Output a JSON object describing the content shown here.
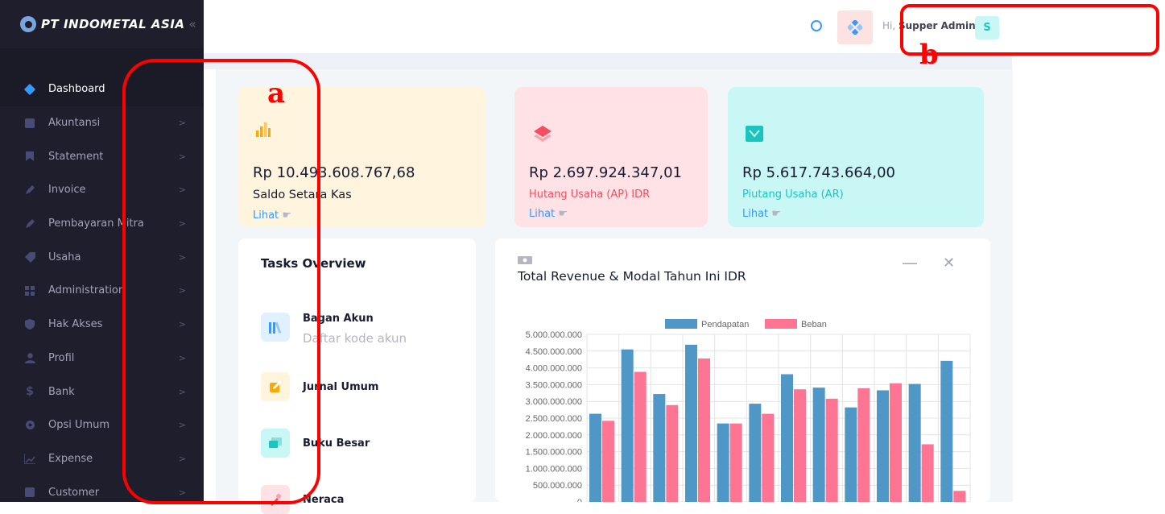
{
  "brand": {
    "name": "PT INDOMETAL ASIA",
    "toggle_icon": "double-chevron-left-icon"
  },
  "sidebar": {
    "items": [
      {
        "label": "Dashboard",
        "icon": "diamond-icon",
        "active": true
      },
      {
        "label": "Akuntansi",
        "icon": "calculator-icon"
      },
      {
        "label": "Statement",
        "icon": "bookmark-icon"
      },
      {
        "label": "Invoice",
        "icon": "pen-icon"
      },
      {
        "label": "Pembayaran Mitra",
        "icon": "pen-icon"
      },
      {
        "label": "Usaha",
        "icon": "tag-icon"
      },
      {
        "label": "Administration",
        "icon": "grid-icon"
      },
      {
        "label": "Hak Akses",
        "icon": "shield-icon"
      },
      {
        "label": "Profil",
        "icon": "user-icon"
      },
      {
        "label": "Bank",
        "icon": "dollar-icon"
      },
      {
        "label": "Opsi Umum",
        "icon": "gear-icon"
      },
      {
        "label": "Expense",
        "icon": "chart-line-icon"
      },
      {
        "label": "Customer",
        "icon": "folder-icon"
      }
    ],
    "chevron": ">"
  },
  "header": {
    "greeting_prefix": "Hi,",
    "user_name": "Supper Admin",
    "avatar_letter": "S"
  },
  "cards": [
    {
      "value": "Rp 10.493.608.767,68",
      "label": "Saldo Setara Kas",
      "link": "Lihat",
      "bg": "#fff4de",
      "label_color": "#181c32"
    },
    {
      "value": "Rp 2.697.924.347,01",
      "label": "Hutang Usaha (AP) IDR",
      "link": "Lihat",
      "bg": "#ffe2e5",
      "label_color": "#f64e60"
    },
    {
      "value": "Rp 5.617.743.664,00",
      "label": "Piutang Usaha (AR)",
      "link": "Lihat",
      "bg": "#c9f7f5",
      "label_color": "#1bc5bd"
    }
  ],
  "tasks": {
    "title": "Tasks Overview",
    "items": [
      {
        "title": "Bagan Akun",
        "subtitle": "Daftar kode akun",
        "bg": "#e1f0ff",
        "icon": "books-icon"
      },
      {
        "title": "Jurnal Umum",
        "subtitle": "",
        "bg": "#fff4de",
        "icon": "edit-icon"
      },
      {
        "title": "Buku Besar",
        "subtitle": "",
        "bg": "#c9f7f5",
        "icon": "chat-icon"
      },
      {
        "title": "Neraca",
        "subtitle": "",
        "bg": "#ffe2e5",
        "icon": "tools-icon"
      }
    ]
  },
  "chart_panel": {
    "title": "Total Revenue & Modal Tahun Ini IDR",
    "minimize_icon": "minus-icon",
    "close_icon": "close-icon"
  },
  "chart_data": {
    "type": "bar",
    "title": "Total Revenue & Modal Tahun Ini IDR",
    "series": [
      {
        "name": "Pendapatan",
        "color": "#4e97c7",
        "values": [
          2630000000,
          4550000000,
          3220000000,
          4690000000,
          2340000000,
          2930000000,
          3810000000,
          3410000000,
          2820000000,
          3330000000,
          3520000000,
          4210000000
        ]
      },
      {
        "name": "Beban",
        "color": "#ff7493",
        "values": [
          2420000000,
          3880000000,
          2890000000,
          4280000000,
          2340000000,
          2630000000,
          3360000000,
          3080000000,
          3390000000,
          3540000000,
          1720000000,
          330000000
        ]
      }
    ],
    "ylim": [
      0,
      5000000000
    ],
    "yticks": [
      "5.000.000.000",
      "4.500.000.000",
      "4.000.000.000",
      "3.500.000.000",
      "3.000.000.000",
      "2.500.000.000",
      "2.000.000.000",
      "1.500.000.000",
      "1.000.000.000",
      "500.000.000",
      "0"
    ],
    "legend": "top-center",
    "grid": true
  },
  "annotations": {
    "a": "a",
    "b": "b"
  }
}
